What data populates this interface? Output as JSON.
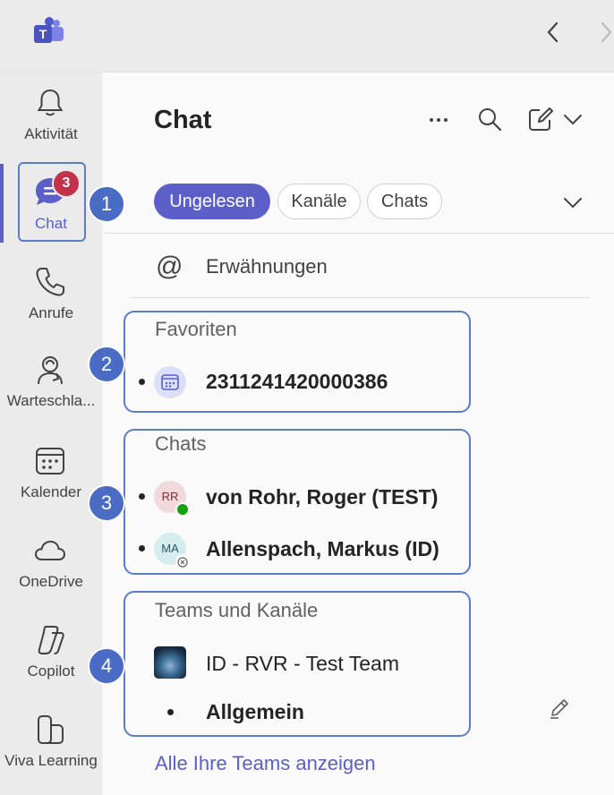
{
  "app": {
    "logo_icon": "teams-logo-icon"
  },
  "topbar": {
    "back_icon": "chevron-left-icon",
    "forward_icon": "chevron-right-icon"
  },
  "rail": {
    "items": [
      {
        "label": "Aktivität",
        "icon": "bell-icon"
      },
      {
        "label": "Chat",
        "icon": "chat-icon",
        "badge": "3",
        "active": true
      },
      {
        "label": "Anrufe",
        "icon": "phone-icon"
      },
      {
        "label": "Warteschla...",
        "icon": "queue-icon"
      },
      {
        "label": "Kalender",
        "icon": "calendar-icon"
      },
      {
        "label": "OneDrive",
        "icon": "cloud-icon"
      },
      {
        "label": "Copilot",
        "icon": "copilot-icon"
      },
      {
        "label": "Viva Learning",
        "icon": "book-icon"
      }
    ]
  },
  "header": {
    "title": "Chat"
  },
  "filters": {
    "unread": "Ungelesen",
    "channels": "Kanäle",
    "chats": "Chats"
  },
  "mentions": {
    "label": "Erwähnungen",
    "icon": "at-icon"
  },
  "favorites": {
    "title": "Favoriten",
    "items": [
      {
        "label": "2311241420000386",
        "icon": "calendar-icon"
      }
    ]
  },
  "chats": {
    "title": "Chats",
    "items": [
      {
        "initials": "RR",
        "name": "von Rohr, Roger (TEST)",
        "status": "available"
      },
      {
        "initials": "MA",
        "name": "Allenspach, Markus (ID)",
        "status": "offline"
      }
    ]
  },
  "teams": {
    "title": "Teams und Kanäle",
    "team_name": "ID - RVR - Test Team",
    "channel": "Allgemein",
    "show_all_link": "Alle Ihre Teams anzeigen"
  },
  "callouts": [
    "1",
    "2",
    "3",
    "4"
  ],
  "colors": {
    "accent": "#5b5fc7",
    "badge": "#c4314b",
    "callout": "#4a6cc4",
    "available": "#13a10e"
  }
}
